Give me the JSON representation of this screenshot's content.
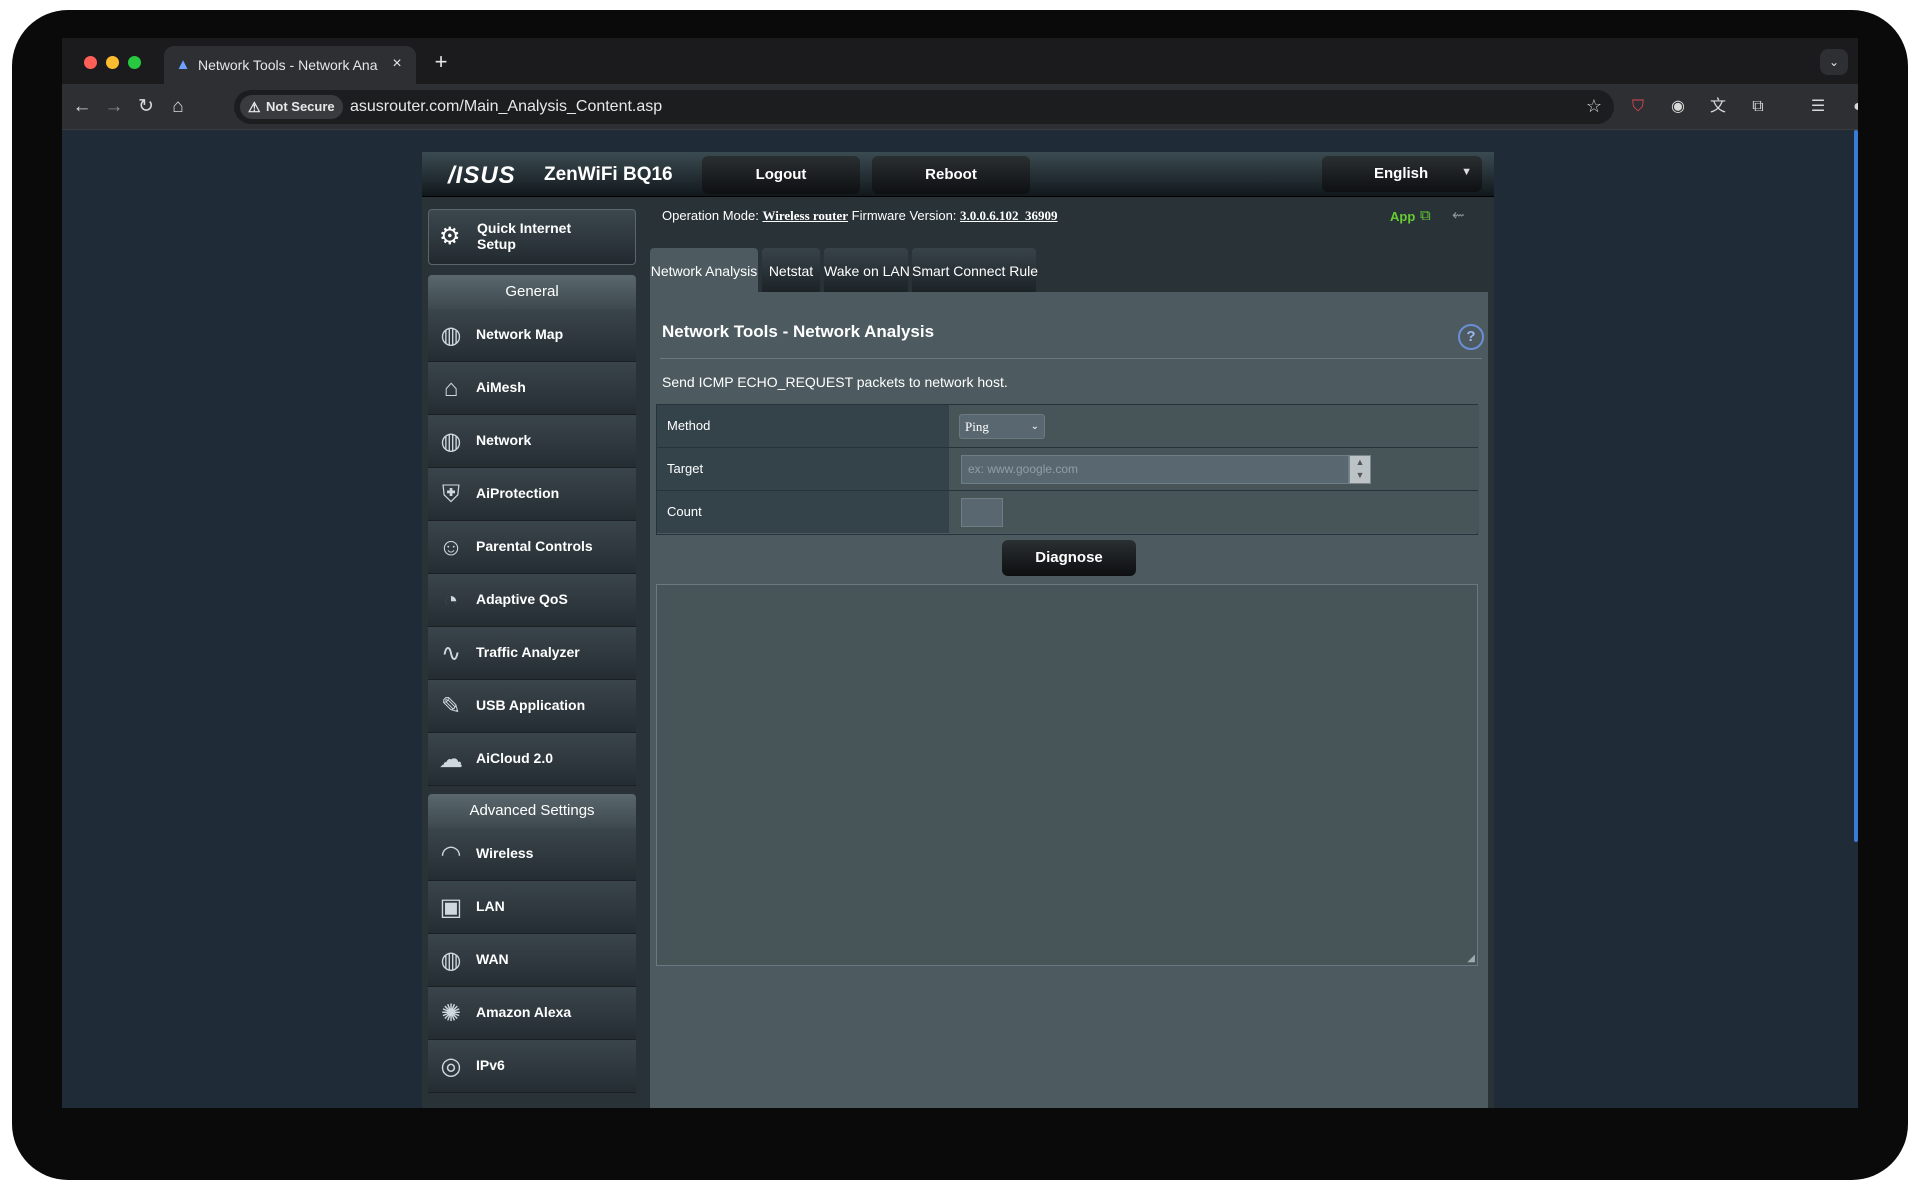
{
  "browser": {
    "tab_title": "Network Tools - Network Ana",
    "tab_close": "×",
    "new_tab": "+",
    "security_label": "Not Secure",
    "url": "asusrouter.com/Main_Analysis_Content.asp"
  },
  "router": {
    "brand": "/ISUS",
    "model": "ZenWiFi BQ16",
    "logout_label": "Logout",
    "reboot_label": "Reboot",
    "language": "English",
    "op_mode_label": "Operation Mode:",
    "op_mode_value": "Wireless router",
    "firmware_label": "Firmware Version:",
    "firmware_value": "3.0.0.6.102_36909",
    "app_label": "App"
  },
  "sidebar": {
    "quick_setup": "Quick Internet Setup",
    "general_header": "General",
    "general_items": [
      {
        "label": "Network Map",
        "icon": "globe-icon"
      },
      {
        "label": "AiMesh",
        "icon": "mesh-icon"
      },
      {
        "label": "Network",
        "icon": "network-globe-icon"
      },
      {
        "label": "AiProtection",
        "icon": "shield-icon"
      },
      {
        "label": "Parental Controls",
        "icon": "family-icon"
      },
      {
        "label": "Adaptive QoS",
        "icon": "gauge-icon"
      },
      {
        "label": "Traffic Analyzer",
        "icon": "pulse-icon"
      },
      {
        "label": "USB Application",
        "icon": "usb-icon"
      },
      {
        "label": "AiCloud 2.0",
        "icon": "cloud-icon"
      }
    ],
    "advanced_header": "Advanced Settings",
    "advanced_items": [
      {
        "label": "Wireless",
        "icon": "wifi-icon"
      },
      {
        "label": "LAN",
        "icon": "lan-icon"
      },
      {
        "label": "WAN",
        "icon": "wan-globe-icon"
      },
      {
        "label": "Amazon Alexa",
        "icon": "alexa-icon"
      },
      {
        "label": "IPv6",
        "icon": "ipv6-icon"
      }
    ]
  },
  "tabs": [
    {
      "label": "Network Analysis",
      "active": true
    },
    {
      "label": "Netstat",
      "active": false
    },
    {
      "label": "Wake on LAN",
      "active": false
    },
    {
      "label": "Smart Connect Rule",
      "active": false
    }
  ],
  "panel": {
    "title": "Network Tools - Network Analysis",
    "help": "?",
    "description": "Send ICMP ECHO_REQUEST packets to network host.",
    "method_label": "Method",
    "method_value": "Ping",
    "target_label": "Target",
    "target_placeholder": "ex: www.google.com",
    "count_label": "Count",
    "diagnose_label": "Diagnose"
  }
}
